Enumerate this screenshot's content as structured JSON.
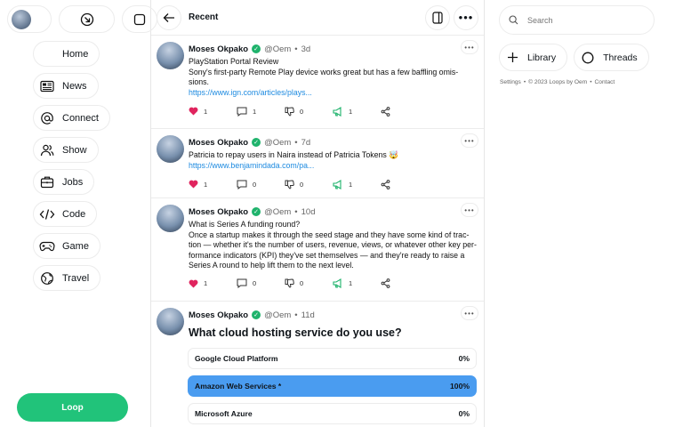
{
  "sidebar": {
    "items": [
      {
        "label": "Home",
        "icon": "home-icon"
      },
      {
        "label": "News",
        "icon": "newspaper-icon"
      },
      {
        "label": "Connect",
        "icon": "at-icon"
      },
      {
        "label": "Show",
        "icon": "people-icon"
      },
      {
        "label": "Jobs",
        "icon": "briefcase-icon"
      },
      {
        "label": "Code",
        "icon": "code-icon"
      },
      {
        "label": "Game",
        "icon": "gamepad-icon"
      },
      {
        "label": "Travel",
        "icon": "globe-icon"
      }
    ],
    "loop_label": "Loop"
  },
  "feed": {
    "title": "Recent",
    "posts": [
      {
        "name": "Moses Okpako",
        "handle": "@Oem",
        "time": "3d",
        "text": "PlayStation Portal Review\nSony's first-party Remote Play device works great but has a few baffling omis-\nsions.",
        "link": "https://www.ign.com/articles/plays...",
        "likes": "1",
        "comments": "1",
        "dislikes": "0",
        "shares": "1"
      },
      {
        "name": "Moses Okpako",
        "handle": "@Oem",
        "time": "7d",
        "text": "Patricia to repay users in Naira instead of Patricia Tokens 🤯",
        "link": "https://www.benjamindada.com/pa...",
        "likes": "1",
        "comments": "0",
        "dislikes": "0",
        "shares": "1"
      },
      {
        "name": "Moses Okpako",
        "handle": "@Oem",
        "time": "10d",
        "text": "What is Series A funding round?\nOnce a startup makes it through the seed stage and they have some kind of trac-\ntion — whether it's the number of users, revenue, views, or whatever other key per-\nformance indicators (KPI) they've set themselves — and they're ready to raise a\nSeries A round to help lift them to the next level.",
        "link": "",
        "likes": "1",
        "comments": "0",
        "dislikes": "0",
        "shares": "1"
      }
    ],
    "poll": {
      "name": "Moses Okpako",
      "handle": "@Oem",
      "time": "11d",
      "question": "What cloud hosting service do you use?",
      "options": [
        {
          "label": "Google Cloud Platform",
          "pct": "0%",
          "selected": false
        },
        {
          "label": "Amazon Web Services *",
          "pct": "100%",
          "selected": true
        },
        {
          "label": "Microsoft Azure",
          "pct": "0%",
          "selected": false
        }
      ]
    }
  },
  "right": {
    "search_placeholder": "Search",
    "library_label": "Library",
    "threads_label": "Threads",
    "footer": {
      "settings": "Settings",
      "copyright": "© 2023 Loops by Oem",
      "contact": "Contact",
      "sep": "•"
    }
  },
  "colors": {
    "accent_green": "#21c37a",
    "link_blue": "#1d8ae0",
    "poll_selected": "#4a9cf0",
    "like_red": "#e0245e",
    "share_green": "#1fb36c"
  }
}
